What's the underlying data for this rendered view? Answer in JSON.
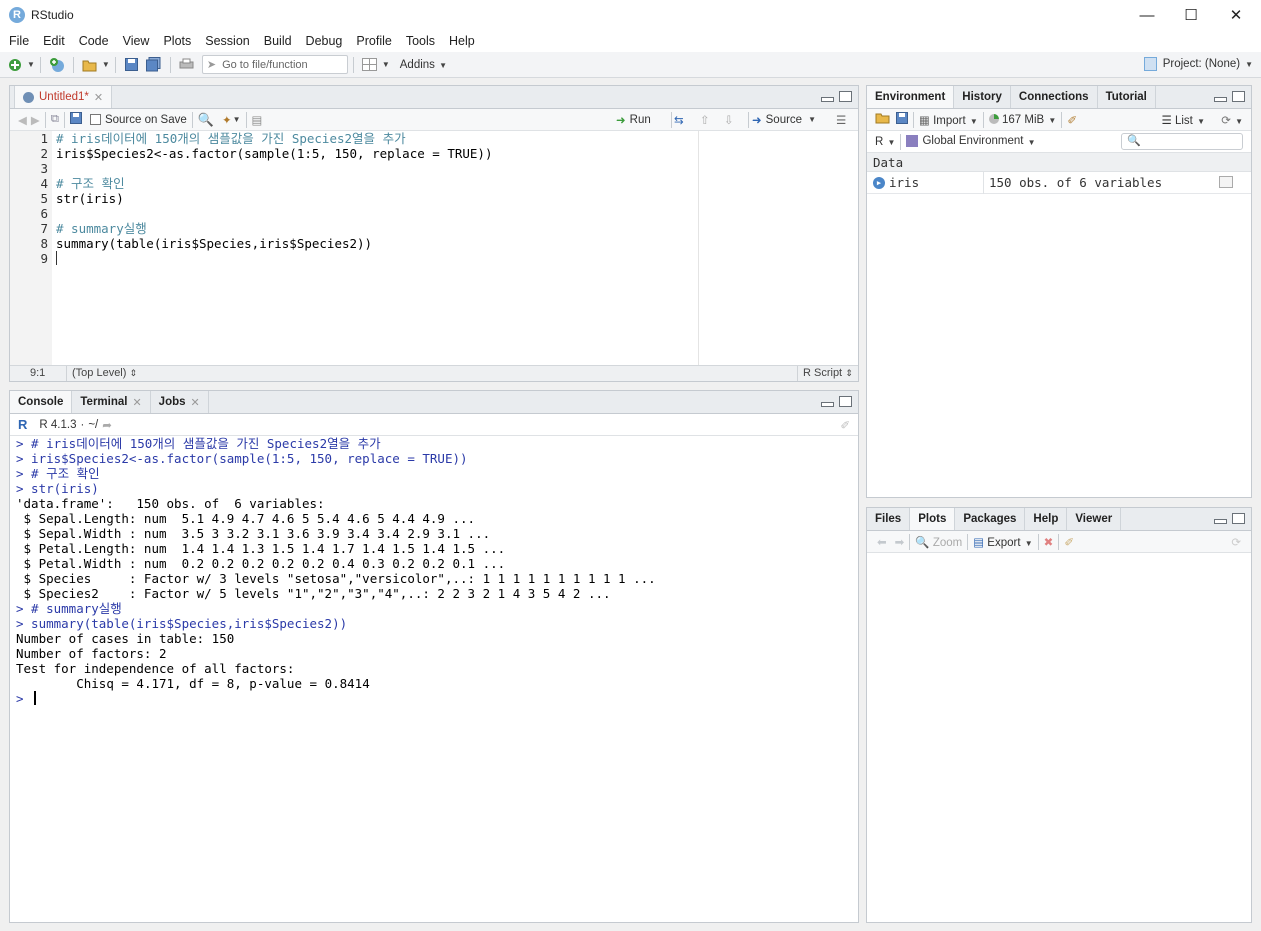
{
  "window": {
    "title": "RStudio",
    "logo_letter": "R"
  },
  "menu": [
    "File",
    "Edit",
    "Code",
    "View",
    "Plots",
    "Session",
    "Build",
    "Debug",
    "Profile",
    "Tools",
    "Help"
  ],
  "toolbar": {
    "goto_placeholder": "Go to file/function",
    "addins_label": "Addins",
    "project_label": "Project: (None)"
  },
  "source": {
    "tab_label": "Untitled1*",
    "source_on_save": "Source on Save",
    "run_label": "Run",
    "source_label": "Source",
    "line_numbers": [
      "1",
      "2",
      "3",
      "4",
      "5",
      "6",
      "7",
      "8",
      "9"
    ],
    "code_lines": [
      "# iris데이터에 150개의 샘플값을 가진 Species2열을 추가",
      "iris$Species2<-as.factor(sample(1:5, 150, replace = TRUE))",
      "",
      "# 구조 확인",
      "str(iris)",
      "",
      "# summary실행",
      "summary(table(iris$Species,iris$Species2))",
      ""
    ],
    "cursor_pos": "9:1",
    "scope": "(Top Level)",
    "file_type": "R Script"
  },
  "console": {
    "tabs": [
      "Console",
      "Terminal",
      "Jobs"
    ],
    "r_version": "R 4.1.3",
    "wd": "~/",
    "lines": [
      {
        "t": "> # iris데이터에 150개의 샘플값을 가진 Species2열을 추가",
        "cmd": true
      },
      {
        "t": "> iris$Species2<-as.factor(sample(1:5, 150, replace = TRUE))",
        "cmd": true
      },
      {
        "t": "> # 구조 확인",
        "cmd": true
      },
      {
        "t": "> str(iris)",
        "cmd": true
      },
      {
        "t": "'data.frame':   150 obs. of  6 variables:",
        "cmd": false
      },
      {
        "t": " $ Sepal.Length: num  5.1 4.9 4.7 4.6 5 5.4 4.6 5 4.4 4.9 ...",
        "cmd": false
      },
      {
        "t": " $ Sepal.Width : num  3.5 3 3.2 3.1 3.6 3.9 3.4 3.4 2.9 3.1 ...",
        "cmd": false
      },
      {
        "t": " $ Petal.Length: num  1.4 1.4 1.3 1.5 1.4 1.7 1.4 1.5 1.4 1.5 ...",
        "cmd": false
      },
      {
        "t": " $ Petal.Width : num  0.2 0.2 0.2 0.2 0.2 0.4 0.3 0.2 0.2 0.1 ...",
        "cmd": false
      },
      {
        "t": " $ Species     : Factor w/ 3 levels \"setosa\",\"versicolor\",..: 1 1 1 1 1 1 1 1 1 1 ...",
        "cmd": false
      },
      {
        "t": " $ Species2    : Factor w/ 5 levels \"1\",\"2\",\"3\",\"4\",..: 2 2 3 2 1 4 3 5 4 2 ...",
        "cmd": false
      },
      {
        "t": "> # summary실행",
        "cmd": true
      },
      {
        "t": "> summary(table(iris$Species,iris$Species2))",
        "cmd": true
      },
      {
        "t": "Number of cases in table: 150 ",
        "cmd": false
      },
      {
        "t": "Number of factors: 2 ",
        "cmd": false
      },
      {
        "t": "Test for independence of all factors:",
        "cmd": false
      },
      {
        "t": "\tChisq = 4.171, df = 8, p-value = 0.8414",
        "cmd": false
      },
      {
        "t": "> ",
        "cmd": true
      }
    ]
  },
  "environment": {
    "tabs": [
      "Environment",
      "History",
      "Connections",
      "Tutorial"
    ],
    "import_label": "Import",
    "memory": "167 MiB",
    "list_label": "List",
    "lang": "R",
    "scope": "Global Environment",
    "section": "Data",
    "rows": [
      {
        "name": "iris",
        "value": "150 obs. of 6 variables"
      }
    ]
  },
  "files": {
    "tabs": [
      "Files",
      "Plots",
      "Packages",
      "Help",
      "Viewer"
    ],
    "zoom_label": "Zoom",
    "export_label": "Export"
  }
}
